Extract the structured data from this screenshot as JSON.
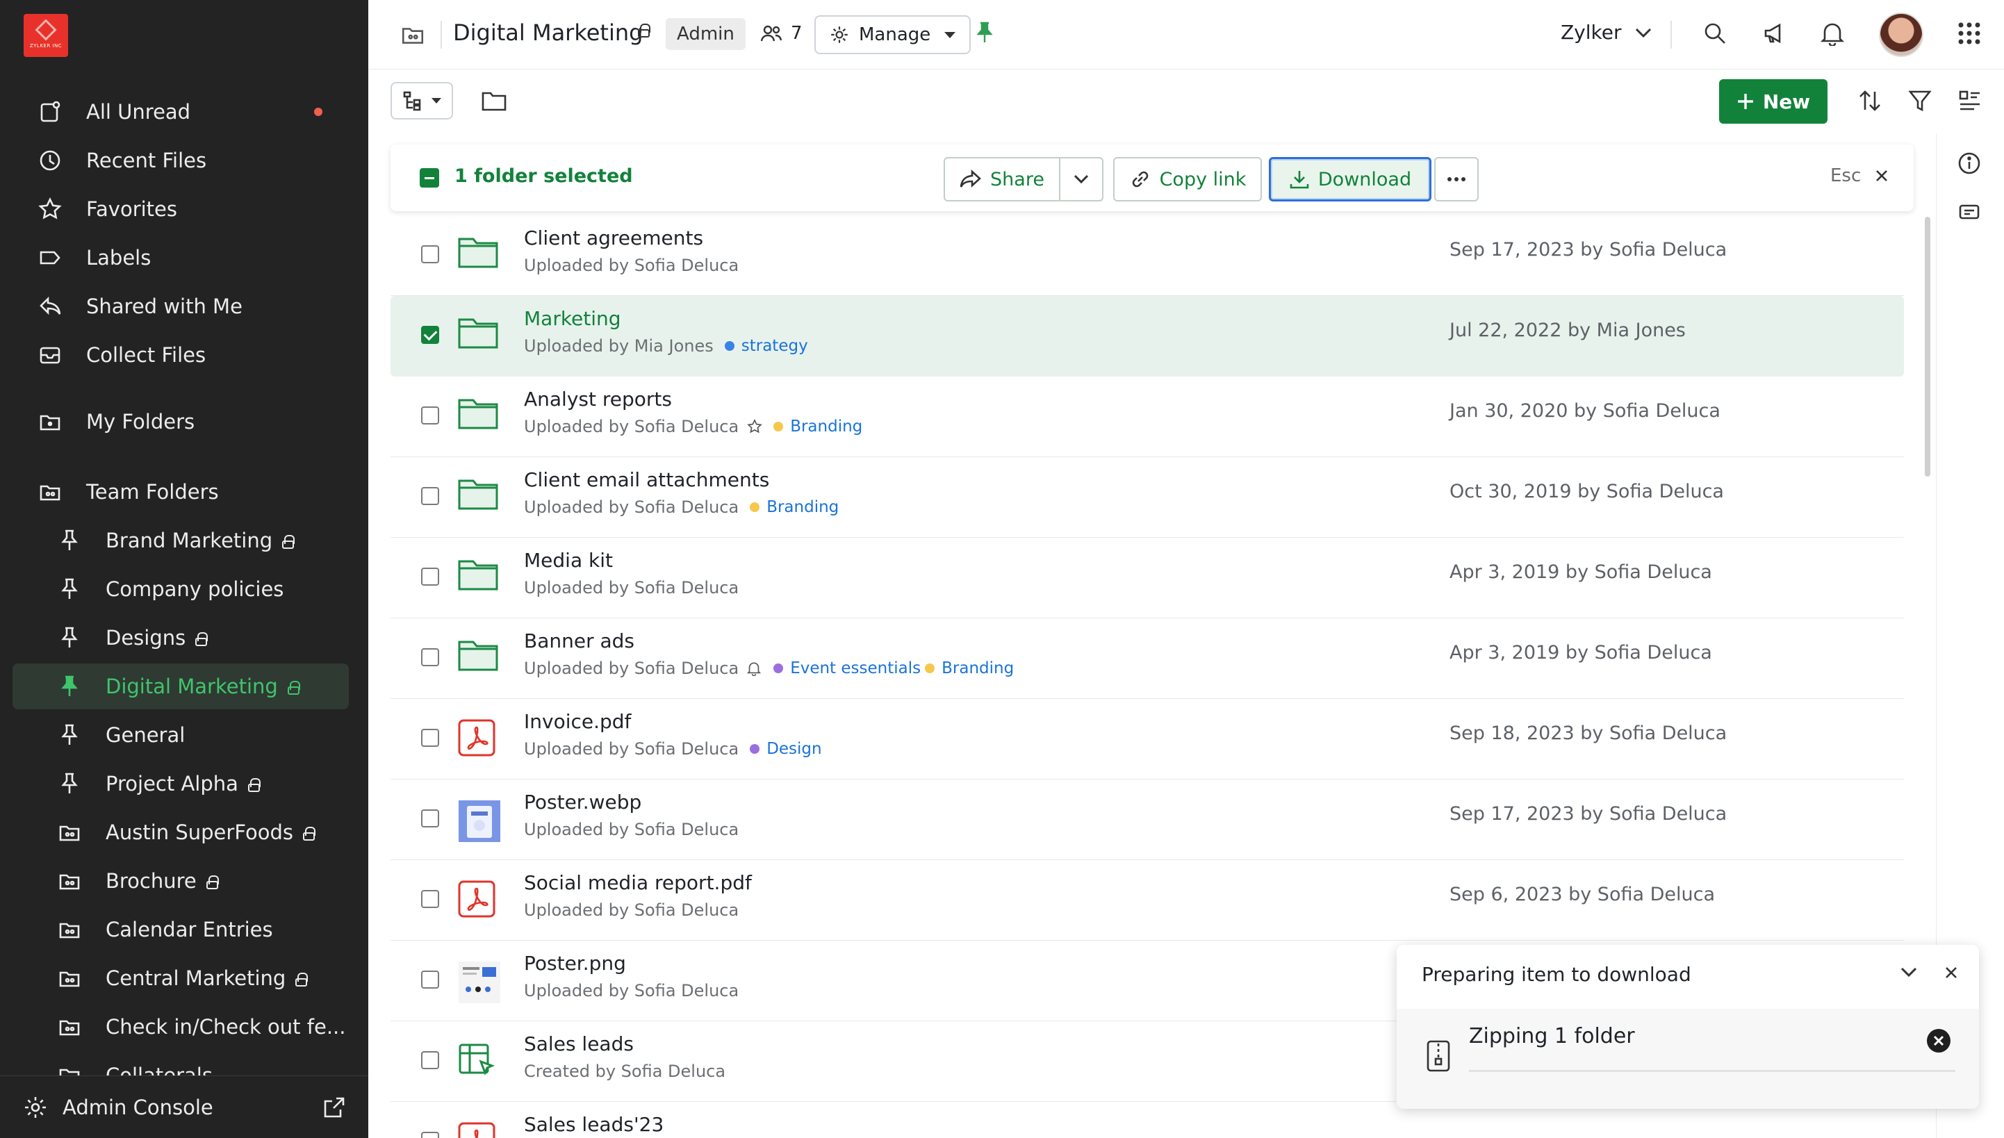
{
  "brand": {
    "logo_text": "ZYLKER INC",
    "accent": "#12823b",
    "logo_color": "#e8312b"
  },
  "sidebar": {
    "items": [
      {
        "label": "All Unread",
        "icon": "unread-icon",
        "unread": true
      },
      {
        "label": "Recent Files",
        "icon": "clock-icon"
      },
      {
        "label": "Favorites",
        "icon": "star-icon"
      },
      {
        "label": "Labels",
        "icon": "label-icon"
      },
      {
        "label": "Shared with Me",
        "icon": "share-back-icon"
      },
      {
        "label": "Collect Files",
        "icon": "inbox-icon"
      },
      {
        "label": "My Folders",
        "icon": "my-folder-icon"
      },
      {
        "label": "Team Folders",
        "icon": "team-folder-icon"
      }
    ],
    "team_folders": [
      {
        "label": "Brand Marketing",
        "icon": "pin-icon",
        "locked": true
      },
      {
        "label": "Company policies",
        "icon": "pin-icon",
        "locked": false
      },
      {
        "label": "Designs",
        "icon": "pin-icon",
        "locked": true
      },
      {
        "label": "Digital Marketing",
        "icon": "pin-icon",
        "locked": true,
        "active": true
      },
      {
        "label": "General",
        "icon": "pin-icon",
        "locked": false
      },
      {
        "label": "Project Alpha",
        "icon": "pin-icon",
        "locked": true
      },
      {
        "label": "Austin SuperFoods",
        "icon": "team-folder-icon",
        "locked": true
      },
      {
        "label": "Brochure",
        "icon": "team-folder-icon",
        "locked": true
      },
      {
        "label": "Calendar Entries",
        "icon": "team-folder-icon",
        "locked": false
      },
      {
        "label": "Central Marketing",
        "icon": "team-folder-icon",
        "locked": true
      },
      {
        "label": "Check in/Check out fe...",
        "icon": "team-folder-icon",
        "locked": false
      },
      {
        "label": "Collaterals",
        "icon": "team-folder-icon",
        "locked": false
      }
    ],
    "admin_console": "Admin Console"
  },
  "header": {
    "title": "Digital Marketing",
    "role": "Admin",
    "member_count": "7",
    "manage": "Manage",
    "org": "Zylker"
  },
  "toolbar": {
    "new_label": "New"
  },
  "selection": {
    "label": "1 folder selected",
    "share": "Share",
    "copy_link": "Copy link",
    "download": "Download",
    "esc": "Esc"
  },
  "files": [
    {
      "name": "Client agreements",
      "sub": "Uploaded by Sofia Deluca",
      "date": "Sep 17, 2023 by Sofia Deluca",
      "type": "folder",
      "tags": []
    },
    {
      "name": "Marketing",
      "sub": "Uploaded by Mia Jones",
      "date": "Jul 22, 2022 by Mia Jones",
      "type": "folder",
      "selected": true,
      "tags": [
        {
          "label": "strategy",
          "color": "#3b82e6"
        }
      ]
    },
    {
      "name": "Analyst reports",
      "sub": "Uploaded by Sofia Deluca",
      "date": "Jan 30, 2020 by Sofia Deluca",
      "type": "folder",
      "star": true,
      "tags": [
        {
          "label": "Branding",
          "color": "#f5c84c"
        }
      ]
    },
    {
      "name": "Client email attachments",
      "sub": "Uploaded by Sofia Deluca",
      "date": "Oct 30, 2019 by Sofia Deluca",
      "type": "folder",
      "tags": [
        {
          "label": "Branding",
          "color": "#f5c84c"
        }
      ]
    },
    {
      "name": "Media kit",
      "sub": "Uploaded by Sofia Deluca",
      "date": "Apr 3, 2019 by Sofia Deluca",
      "type": "folder",
      "tags": []
    },
    {
      "name": "Banner ads",
      "sub": "Uploaded by Sofia Deluca",
      "date": "Apr 3, 2019 by Sofia Deluca",
      "type": "folder",
      "bell": true,
      "tags": [
        {
          "label": "Event essentials",
          "color": "#9b6ee0"
        },
        {
          "label": "Branding",
          "color": "#f5c84c"
        }
      ]
    },
    {
      "name": "Invoice.pdf",
      "sub": "Uploaded by Sofia Deluca",
      "date": "Sep 18, 2023 by Sofia Deluca",
      "type": "pdf",
      "tags": [
        {
          "label": "Design",
          "color": "#9b6ee0"
        }
      ]
    },
    {
      "name": "Poster.webp",
      "sub": "Uploaded by Sofia Deluca",
      "date": "Sep 17, 2023 by Sofia Deluca",
      "type": "image",
      "tags": []
    },
    {
      "name": "Social media report.pdf",
      "sub": "Uploaded by Sofia Deluca",
      "date": "Sep 6, 2023 by Sofia Deluca",
      "type": "pdf",
      "tags": []
    },
    {
      "name": "Poster.png",
      "sub": "Uploaded by Sofia Deluca",
      "date": "",
      "type": "image2",
      "tags": []
    },
    {
      "name": "Sales leads",
      "sub": "Created by Sofia Deluca",
      "date": "",
      "type": "sheet",
      "tags": []
    },
    {
      "name": "Sales leads'23",
      "sub": "",
      "date": "",
      "type": "pdf",
      "tags": []
    }
  ],
  "download_panel": {
    "title": "Preparing item to download",
    "item": "Zipping 1 folder"
  }
}
